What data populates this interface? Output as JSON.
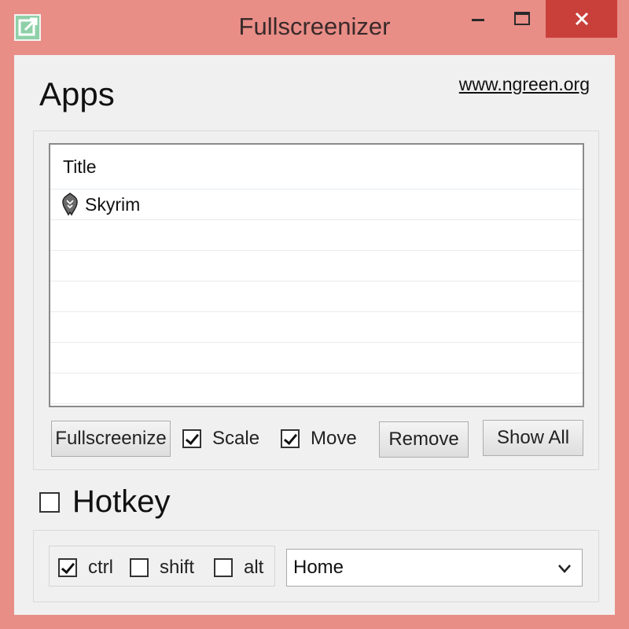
{
  "window": {
    "title": "Fullscreenizer",
    "controls": {
      "minimize": "—",
      "maximize": "☐",
      "close": "✕"
    },
    "colors": {
      "frame": "#e98d87",
      "close": "#c9403a",
      "client": "#f0f0f0"
    }
  },
  "apps": {
    "heading": "Apps",
    "link": "www.ngreen.org",
    "list": {
      "column_header": "Title",
      "rows": [
        {
          "icon": "skyrim-dragon-icon",
          "title": "Skyrim"
        }
      ]
    },
    "buttons": {
      "fullscreenize": "Fullscreenize",
      "remove": "Remove",
      "show_all": "Show All"
    },
    "checkboxes": {
      "scale": {
        "label": "Scale",
        "checked": true
      },
      "move": {
        "label": "Move",
        "checked": true
      }
    }
  },
  "hotkey": {
    "label": "Hotkey",
    "checked": false,
    "modifiers": {
      "ctrl": {
        "label": "ctrl",
        "checked": true
      },
      "shift": {
        "label": "shift",
        "checked": false
      },
      "alt": {
        "label": "alt",
        "checked": false
      }
    },
    "key": {
      "selected": "Home"
    }
  }
}
